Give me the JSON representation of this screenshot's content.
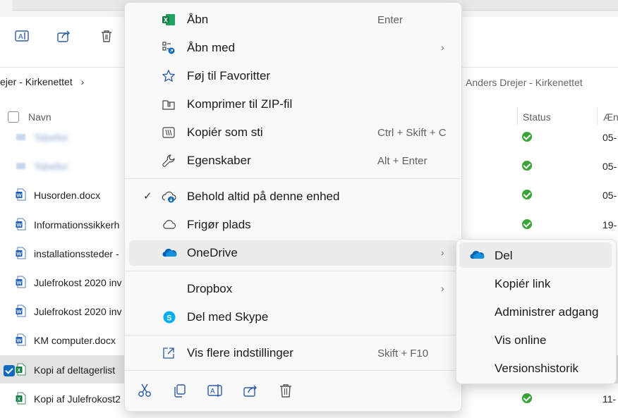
{
  "explorer": {
    "breadcrumb_left": "ejer - Kirkenettet",
    "breadcrumb_right": "Anders Drejer - Kirkenettet",
    "columns": {
      "name": "Navn",
      "status": "Status",
      "modified": "Æn"
    },
    "rows": [
      {
        "name": "Tabeller",
        "date": "05-",
        "blurred": true,
        "icon": "folder-icon",
        "selected": false
      },
      {
        "name": "Tabeller",
        "date": "05-",
        "blurred": true,
        "icon": "folder-icon",
        "selected": false
      },
      {
        "name": "Husorden.docx",
        "date": "05-",
        "blurred": false,
        "icon": "word-icon",
        "selected": false
      },
      {
        "name": "Informationssikkerh",
        "date": "19-",
        "blurred": false,
        "icon": "word-icon",
        "selected": false
      },
      {
        "name": "installationssteder -",
        "date": "",
        "blurred": false,
        "icon": "word-icon",
        "selected": false
      },
      {
        "name": "Julefrokost 2020 inv",
        "date": "",
        "blurred": false,
        "icon": "word-icon",
        "selected": false
      },
      {
        "name": "Julefrokost 2020 inv",
        "date": "",
        "blurred": false,
        "icon": "word-icon",
        "selected": false
      },
      {
        "name": "KM computer.docx",
        "date": "",
        "blurred": false,
        "icon": "word-icon",
        "selected": false
      },
      {
        "name": "Kopi af deltagerlist",
        "date": "",
        "blurred": false,
        "icon": "excel-icon",
        "selected": true
      },
      {
        "name": "Kopi af Julefrokost2",
        "date": "11-",
        "blurred": false,
        "icon": "excel-icon",
        "selected": false
      }
    ]
  },
  "context_menu": {
    "items": [
      {
        "label": "Åbn",
        "shortcut": "Enter",
        "icon": "excel-icon"
      },
      {
        "label": "Åbn med",
        "shortcut": "",
        "icon": "open-with-icon",
        "submenu": true
      },
      {
        "label": "Føj til Favoritter",
        "shortcut": "",
        "icon": "star-icon"
      },
      {
        "label": "Komprimer til ZIP-fil",
        "shortcut": "",
        "icon": "zip-icon"
      },
      {
        "label": "Kopiér som sti",
        "shortcut": "Ctrl + Skift + C",
        "icon": "copy-path-icon"
      },
      {
        "label": "Egenskaber",
        "shortcut": "Alt + Enter",
        "icon": "wrench-icon"
      },
      {
        "label": "Behold altid på denne enhed",
        "shortcut": "",
        "icon": "cloud-download-icon",
        "checked": true
      },
      {
        "label": "Frigør plads",
        "shortcut": "",
        "icon": "cloud-icon"
      },
      {
        "label": "OneDrive",
        "shortcut": "",
        "icon": "onedrive-icon",
        "submenu": true
      },
      {
        "label": "Dropbox",
        "shortcut": "",
        "icon": "",
        "submenu": true
      },
      {
        "label": "Del med Skype",
        "shortcut": "",
        "icon": "skype-icon"
      },
      {
        "label": "Vis flere indstillinger",
        "shortcut": "Skift + F10",
        "icon": "more-options-icon"
      }
    ],
    "check_mark": "✓",
    "chevron": "›"
  },
  "onedrive_submenu": {
    "items": [
      {
        "label": "Del",
        "icon": "onedrive-icon"
      },
      {
        "label": "Kopiér link"
      },
      {
        "label": "Administrer adgang"
      },
      {
        "label": "Vis online"
      },
      {
        "label": "Versionshistorik"
      }
    ]
  },
  "colors": {
    "accent": "#0f6cbd",
    "excel_green": "#107c41",
    "word_blue": "#185abd",
    "onedrive_blue": "#0364b8",
    "skype_blue": "#00aff0",
    "status_green": "#3aa537"
  }
}
